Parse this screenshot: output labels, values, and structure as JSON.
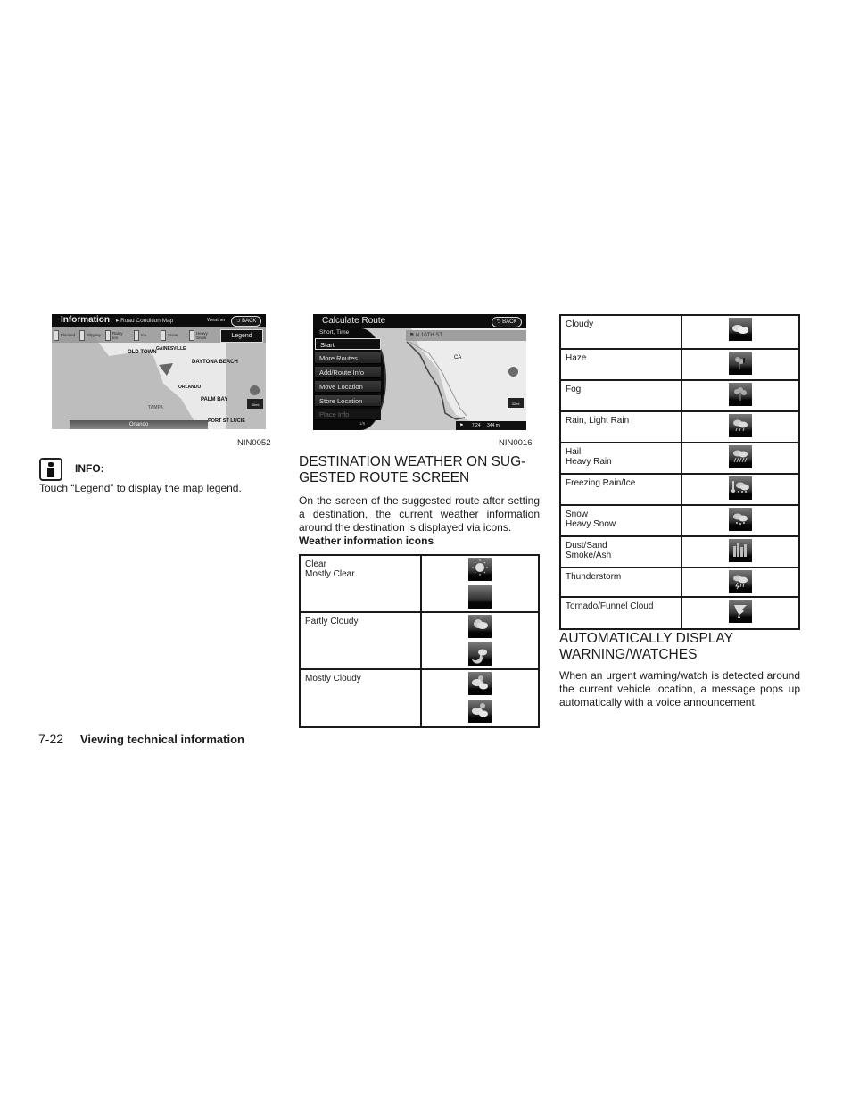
{
  "figure1": {
    "title": "Information",
    "breadcrumb": "Road Condition Map",
    "weather_label": "Weather",
    "back_label": "BACK",
    "legend_items": [
      "Flooded",
      "Slippery",
      "Rainy Ice",
      "Ice",
      "Snow",
      "Heavy Snow"
    ],
    "legend_button": "Legend",
    "map_labels": [
      "OLD TOWN",
      "GAINESVILLE",
      "DAYTONA BEACH",
      "ORLANDO",
      "PALM BAY",
      "TAMPA",
      "PORT ST LUCIE"
    ],
    "current_city": "Orlando",
    "scale": "30mi",
    "figure_id": "NIN0052"
  },
  "figure2": {
    "title": "Calculate Route",
    "back_label": "BACK",
    "menu_caption": "Short, Time",
    "menu_items": [
      {
        "label": "Start",
        "state": "selected"
      },
      {
        "label": "More Routes",
        "state": "normal"
      },
      {
        "label": "Add/Route Info",
        "state": "normal"
      },
      {
        "label": "Move Location",
        "state": "normal"
      },
      {
        "label": "Store Location",
        "state": "normal"
      },
      {
        "label": "Place Info",
        "state": "disabled"
      }
    ],
    "page_indicator": "1/6",
    "street": "N 10TH ST",
    "map_label": "CA",
    "scale": "32mi",
    "time": "7:24",
    "distance": "344 m",
    "figure_id": "NIN0016"
  },
  "info": {
    "label": "INFO:",
    "text": "Touch “Legend” to display the map legend."
  },
  "destination_weather": {
    "heading": "DESTINATION WEATHER ON SUG-\nGESTED ROUTE SCREEN",
    "heading_line1": "DESTINATION WEATHER ON SUG-",
    "heading_line2": "GESTED ROUTE SCREEN",
    "paragraph": "On the screen of the suggested route after setting a destination, the current weather information around the destination is displayed via icons.",
    "subheading": "Weather information icons",
    "table": [
      {
        "label": "Clear\nMostly Clear",
        "icons": [
          "sun-icon",
          "moon-icon"
        ]
      },
      {
        "label": "Partly Cloudy",
        "icons": [
          "sun-cloud-icon",
          "moon-cloud-icon"
        ]
      },
      {
        "label": "Mostly Cloudy",
        "icons": [
          "sun-clouds-icon",
          "moon-clouds-icon"
        ]
      }
    ]
  },
  "weather_table_2": [
    {
      "label": "Cloudy",
      "icon": "cloudy-icon"
    },
    {
      "label": "Haze",
      "icon": "haze-icon"
    },
    {
      "label": "Fog",
      "icon": "fog-icon"
    },
    {
      "label": "Rain, Light Rain",
      "icon": "rain-icon"
    },
    {
      "label": "Hail\nHeavy Rain",
      "icon": "heavy-rain-icon"
    },
    {
      "label": "Freezing Rain/Ice",
      "icon": "freezing-rain-icon"
    },
    {
      "label": "Snow\nHeavy Snow",
      "icon": "snow-icon"
    },
    {
      "label": "Dust/Sand\nSmoke/Ash",
      "icon": "dust-icon"
    },
    {
      "label": "Thunderstorm",
      "icon": "thunderstorm-icon"
    },
    {
      "label": "Tornado/Funnel Cloud",
      "icon": "tornado-icon"
    }
  ],
  "auto_warning": {
    "heading_line1": "AUTOMATICALLY DISPLAY",
    "heading_line2": "WARNING/WATCHES",
    "paragraph": "When an urgent warning/watch is detected around the current vehicle location, a message pops up automatically with a voice announcement."
  },
  "footer": {
    "page_number": "7-22",
    "section_title": "Viewing technical information"
  }
}
